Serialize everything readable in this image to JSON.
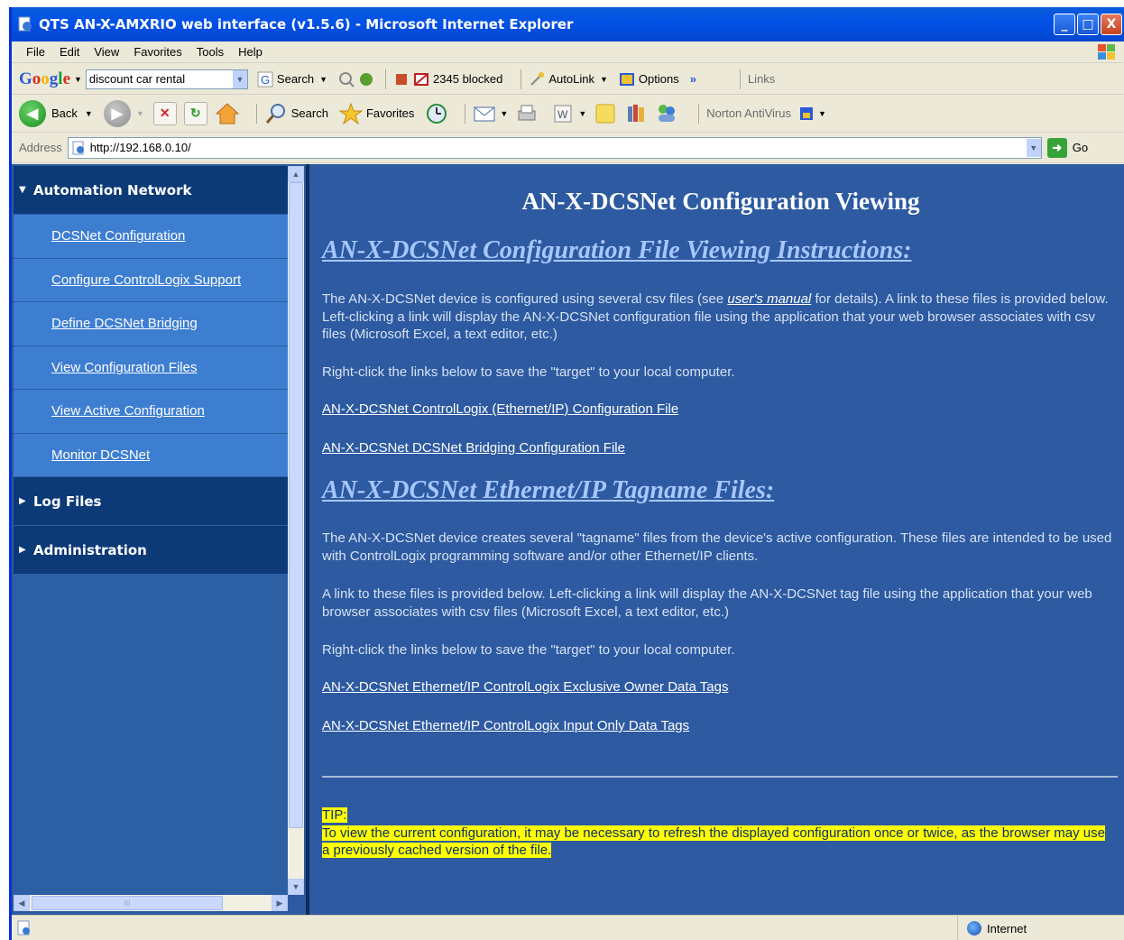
{
  "window": {
    "title": "QTS AN-X-AMXRIO web interface (v1.5.6) - Microsoft Internet Explorer",
    "buttons": {
      "minimize": "_",
      "maximize": "□",
      "close": "X"
    }
  },
  "menubar": {
    "items": [
      "File",
      "Edit",
      "View",
      "Favorites",
      "Tools",
      "Help"
    ]
  },
  "google_toolbar": {
    "logo": [
      "G",
      "o",
      "o",
      "g",
      "l",
      "e"
    ],
    "search_value": "discount car rental",
    "search_label": "Search",
    "blocked_label": "2345 blocked",
    "autolink_label": "AutoLink",
    "options_label": "Options",
    "more": "»",
    "links_label": "Links"
  },
  "std_toolbar": {
    "back_label": "Back",
    "search_label": "Search",
    "favorites_label": "Favorites",
    "norton_label": "Norton AntiVirus"
  },
  "address_bar": {
    "label": "Address",
    "url": "http://192.168.0.10/",
    "go_label": "Go"
  },
  "sidebar": {
    "sections": [
      {
        "label": "Automation Network",
        "expanded": true,
        "items": [
          {
            "label": "DCSNet Configuration"
          },
          {
            "label": "Configure ControlLogix Support"
          },
          {
            "label": "Define DCSNet Bridging"
          },
          {
            "label": "View Configuration Files"
          },
          {
            "label": "View Active Configuration"
          },
          {
            "label": "Monitor DCSNet"
          }
        ]
      },
      {
        "label": "Log Files",
        "expanded": false
      },
      {
        "label": "Administration",
        "expanded": false
      }
    ],
    "hscroll_grip": "III"
  },
  "main": {
    "title": "AN-X-DCSNet Configuration Viewing",
    "section1_heading": "AN-X-DCSNet Configuration File Viewing Instructions:",
    "para1_a": "The AN-X-DCSNet device is configured using several csv files (see ",
    "para1_manual": "user's manual",
    "para1_b": " for details). A link to these files is provided below. Left-clicking a link will display the AN-X-DCSNet configuration file using the application that your web browser associates with csv files (Microsoft Excel, a text editor, etc.)",
    "para2": "Right-click the links below to save the \"target\" to your local computer.",
    "link1": "AN-X-DCSNet ControlLogix (Ethernet/IP) Configuration File",
    "link2": "AN-X-DCSNet DCSNet Bridging Configuration File",
    "section2_heading": "AN-X-DCSNet Ethernet/IP Tagname Files:",
    "para3": "The AN-X-DCSNet device creates several \"tagname\" files from the device's active configuration. These files are intended to be used with ControlLogix programming software and/or other Ethernet/IP clients.",
    "para4": "A link to these files is provided below. Left-clicking a link will display the AN-X-DCSNet tag file using the application that your web browser associates with csv files (Microsoft Excel, a text editor, etc.)",
    "para5": "Right-click the links below to save the \"target\" to your local computer.",
    "link3": "AN-X-DCSNet Ethernet/IP ControlLogix Exclusive Owner Data Tags",
    "link4": "AN-X-DCSNet Ethernet/IP ControlLogix Input Only Data Tags",
    "tip_label": "TIP:",
    "tip_text": "To view the current configuration, it may be necessary to refresh the displayed configuration once or twice, as the browser may use a previously cached version of the file."
  },
  "statusbar": {
    "zone": "Internet"
  },
  "colors": {
    "content_bg": "#2d5aa0",
    "nav_section": "#0c3a77",
    "nav_item": "#3d7ed1",
    "tip_highlight": "#ffff00"
  }
}
